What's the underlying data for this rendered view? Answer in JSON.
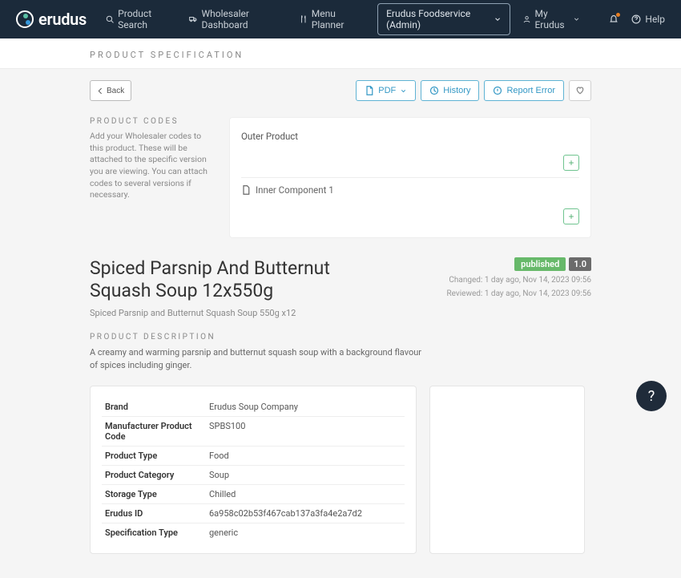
{
  "brand": "erudus",
  "nav": {
    "product_search": "Product Search",
    "wholesaler_dashboard": "Wholesaler Dashboard",
    "menu_planner": "Menu Planner"
  },
  "workspace": "Erudus Foodservice (Admin)",
  "my_erudus": "My Erudus",
  "help": "Help",
  "page_title": "PRODUCT SPECIFICATION",
  "back_label": "Back",
  "actions": {
    "pdf": "PDF",
    "history": "History",
    "report_error": "Report Error"
  },
  "codes": {
    "heading": "PRODUCT CODES",
    "help": "Add your Wholesaler codes to this product. These will be attached to the specific version you are viewing. You can attach codes to several versions if necessary.",
    "outer": "Outer Product",
    "inner": "Inner Component 1"
  },
  "product": {
    "title": "Spiced Parsnip And Butternut Squash Soup 12x550g",
    "subtitle": "Spiced Parsnip and Butternut Squash Soup 550g x12",
    "status": "published",
    "version": "1.0",
    "changed": "Changed: 1 day ago, Nov 14, 2023 09:56",
    "reviewed": "Reviewed: 1 day ago, Nov 14, 2023 09:56"
  },
  "description": {
    "heading": "PRODUCT DESCRIPTION",
    "text": "A creamy and warming parsnip and butternut squash soup with a background flavour of spices including ginger."
  },
  "spec": {
    "brand_k": "Brand",
    "brand_v": "Erudus Soup Company",
    "mpc_k": "Manufacturer Product Code",
    "mpc_v": "SPBS100",
    "type_k": "Product Type",
    "type_v": "Food",
    "cat_k": "Product Category",
    "cat_v": "Soup",
    "storage_k": "Storage Type",
    "storage_v": "Chilled",
    "eid_k": "Erudus ID",
    "eid_v": "6a958c02b53f467cab137a3fa4e2a7d2",
    "st_k": "Specification Type",
    "st_v": "generic"
  }
}
